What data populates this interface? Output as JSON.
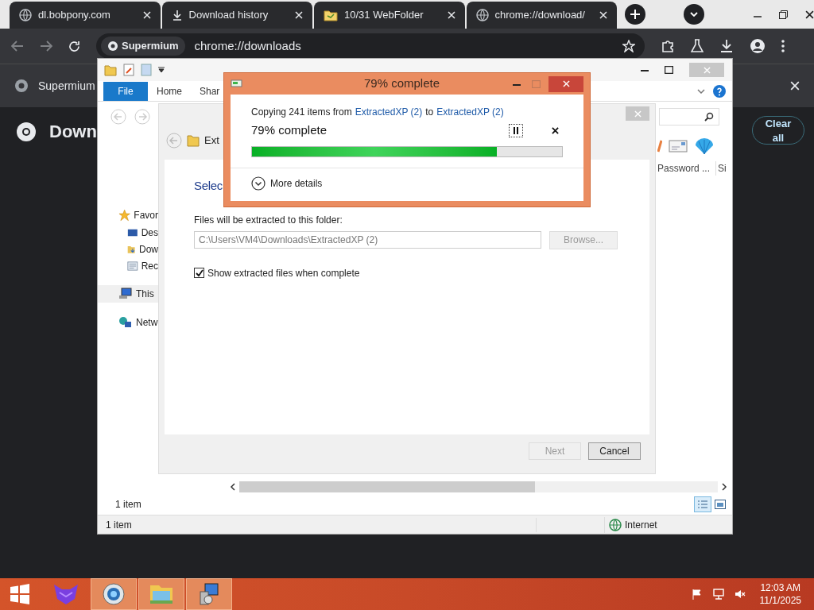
{
  "browser": {
    "tabs": [
      {
        "title": "dl.bobpony.com",
        "kind": "globe",
        "selected": false
      },
      {
        "title": "Download history",
        "kind": "download",
        "selected": false
      },
      {
        "title": "10/31 WebFolder",
        "kind": "folder",
        "selected": false
      },
      {
        "title": "chrome://download/",
        "kind": "globe",
        "selected": false
      }
    ],
    "address_chip": "Supermium",
    "url": "chrome://downloads",
    "infobar": "Supermium",
    "page_heading": "Down",
    "clear_button": "Clear all"
  },
  "explorer": {
    "ribbon_tabs": [
      {
        "label": "File",
        "selected": true
      },
      {
        "label": "Home",
        "selected": false
      },
      {
        "label": "Shar",
        "selected": false
      }
    ],
    "nav": [
      {
        "label": "Favor",
        "kind": "star",
        "children": [
          {
            "label": "Des",
            "kind": "desktop"
          },
          {
            "label": "Dow",
            "kind": "downloads"
          },
          {
            "label": "Rec",
            "kind": "recent"
          }
        ]
      },
      {
        "label": "This",
        "kind": "computer"
      },
      {
        "label": "Netw",
        "kind": "network"
      }
    ],
    "column_headers": [
      "Password ...",
      "Si"
    ],
    "item_count": "1 item",
    "status_bar": {
      "items": "1 item",
      "zone": "Internet"
    }
  },
  "wizard": {
    "heading": "Ext",
    "title": "Selec",
    "folder_label": "Files will be extracted to this folder:",
    "path": "C:\\Users\\VM4\\Downloads\\ExtractedXP (2)",
    "browse": {
      "label": "Browse...",
      "disabled": true
    },
    "show_files": {
      "label": "Show extracted files when complete",
      "checked": true
    },
    "buttons": [
      {
        "label": "Next",
        "disabled": true
      },
      {
        "label": "Cancel",
        "disabled": false
      }
    ]
  },
  "copy_dialog": {
    "title": "79% complete",
    "message": [
      {
        "text": "Copying 241 items from",
        "kind": "plain"
      },
      {
        "text": "ExtractedXP (2)",
        "kind": "link"
      },
      {
        "text": "to",
        "kind": "plain"
      },
      {
        "text": "ExtractedXP (2)",
        "kind": "link"
      }
    ],
    "status": "79% complete",
    "progress": {
      "level": 0.79
    },
    "more_details": "More details"
  },
  "taskbar": {
    "apps": [
      {
        "kind": "fox",
        "selected": false
      },
      {
        "kind": "browser",
        "selected": true
      },
      {
        "kind": "explorer",
        "selected": true
      },
      {
        "kind": "installer",
        "selected": true
      }
    ],
    "time": "12:03 AM",
    "date": "11/1/2025"
  }
}
